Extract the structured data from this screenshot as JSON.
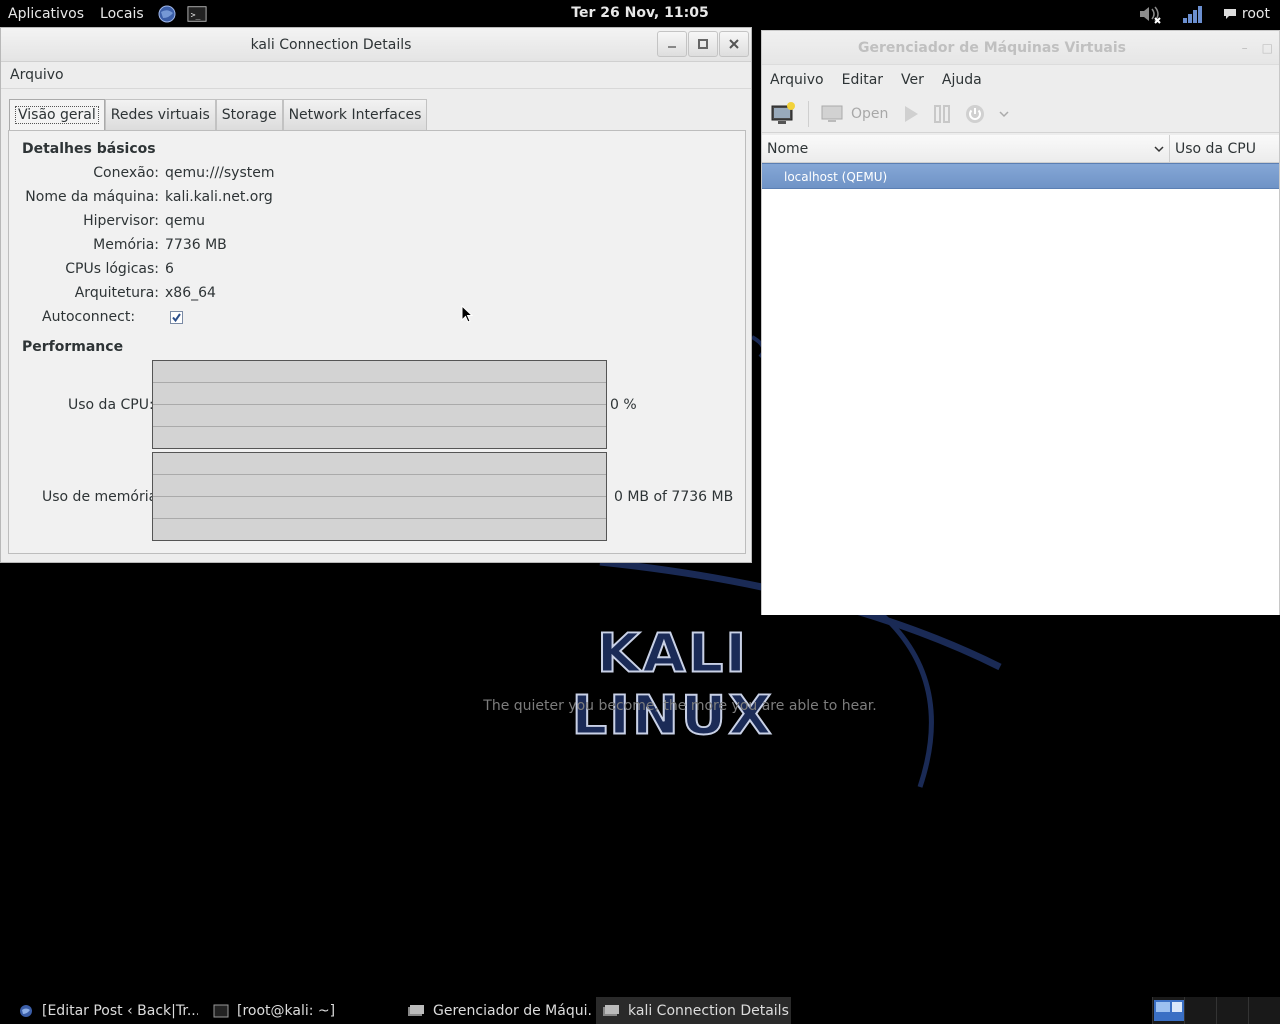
{
  "top_panel": {
    "applications": "Aplicativos",
    "places": "Locais",
    "clock": "Ter 26 Nov, 11:05",
    "user": "root",
    "launchers": [
      "browser-icon",
      "terminal-icon"
    ]
  },
  "desktop": {
    "logo_text": "KALI LINUX",
    "tagline": "The quieter you become, the more you are able to hear."
  },
  "details_window": {
    "title": "kali Connection Details",
    "menu": [
      "Arquivo"
    ],
    "tabs": [
      "Visão geral",
      "Redes virtuais",
      "Storage",
      "Network Interfaces"
    ],
    "active_tab": 0,
    "basic_section": "Detalhes básicos",
    "fields": [
      {
        "label": "Conexão:",
        "value": "qemu:///system"
      },
      {
        "label": "Nome da máquina:",
        "value": "kali.kali.net.org"
      },
      {
        "label": "Hipervisor:",
        "value": "qemu"
      },
      {
        "label": "Memória:",
        "value": "7736 MB"
      },
      {
        "label": "CPUs lógicas:",
        "value": "6"
      },
      {
        "label": "Arquitetura:",
        "value": "x86_64"
      }
    ],
    "autoconnect_label": "Autoconnect:",
    "autoconnect_checked": true,
    "performance_section": "Performance",
    "cpu_label": "Uso da CPU:",
    "cpu_value": "0 %",
    "mem_label": "Uso de memória:",
    "mem_value": "0 MB of 7736 MB"
  },
  "vmm_window": {
    "title": "Gerenciador de Máquinas Virtuais",
    "menu": [
      "Arquivo",
      "Editar",
      "Ver",
      "Ajuda"
    ],
    "toolbar": {
      "open_label": "Open"
    },
    "columns": [
      "Nome",
      "Uso da CPU"
    ],
    "rows": [
      "localhost (QEMU)"
    ]
  },
  "taskbar": {
    "tasks": [
      "[Editar Post ‹ Back|Tr...",
      "[root@kali: ~]",
      "Gerenciador de Máqui...",
      "kali Connection Details"
    ],
    "active_task": 3
  },
  "colors": {
    "selection": "#7a9dcd",
    "logo": "#1b2b57"
  }
}
